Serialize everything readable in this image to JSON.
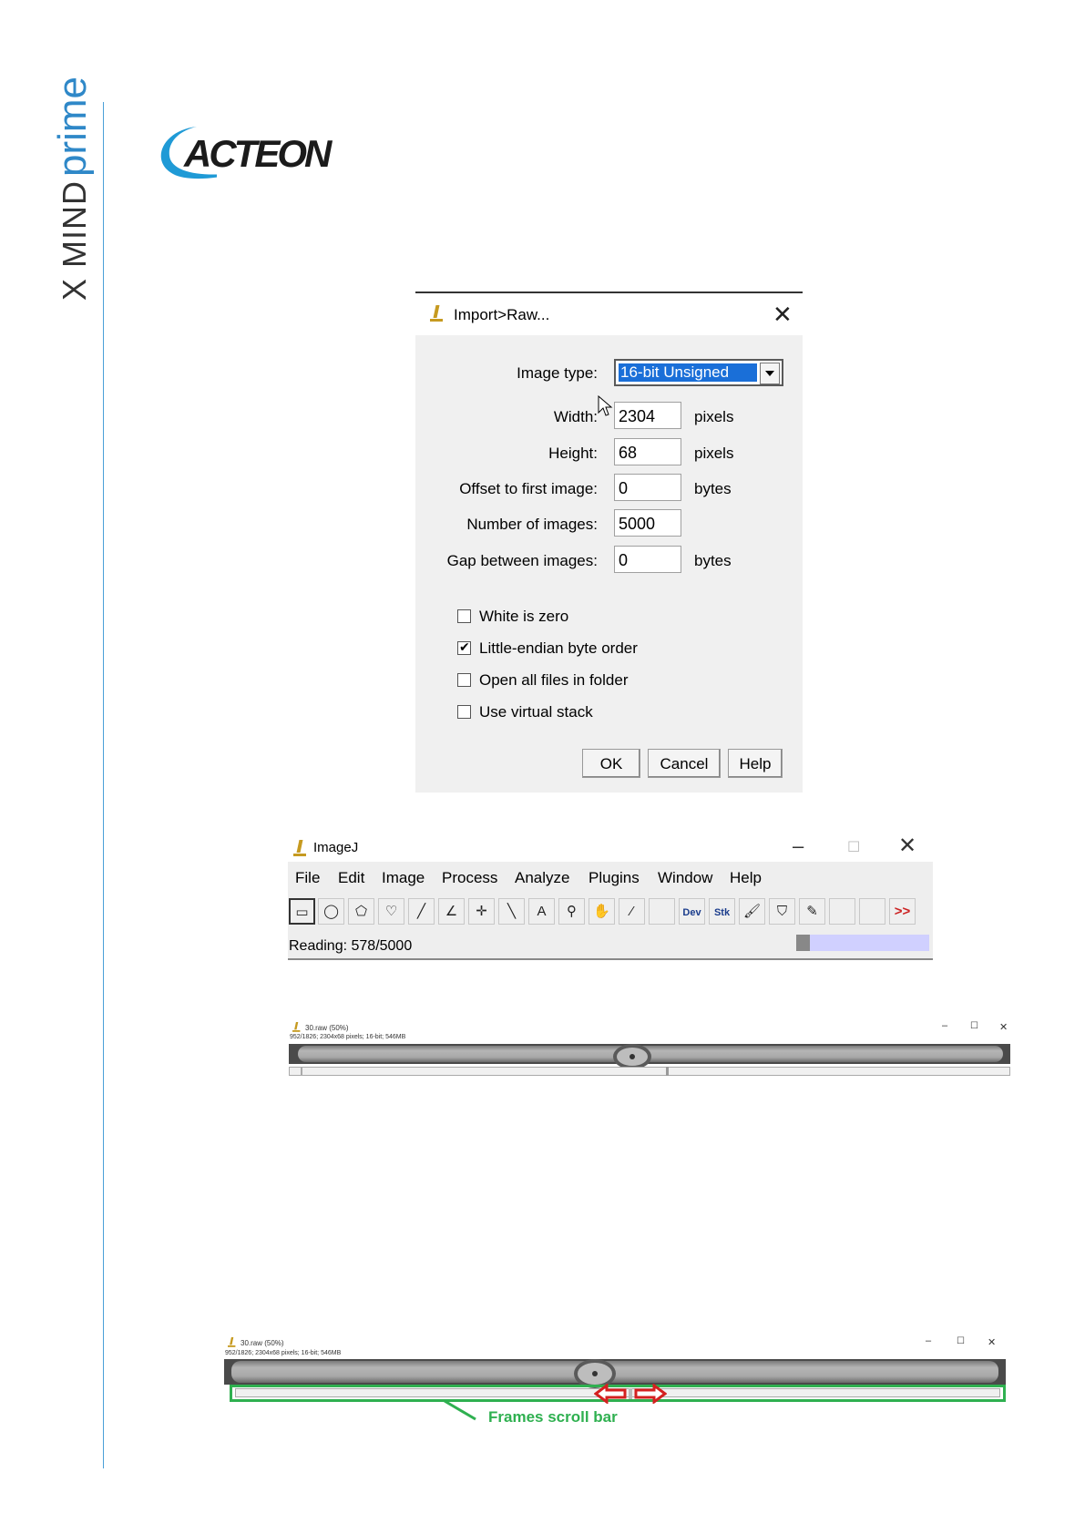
{
  "brand": {
    "vertical_part1": "X MIND",
    "vertical_part2": "prime",
    "logo_text": "ACTEON"
  },
  "dialog": {
    "title": "Import>Raw...",
    "image_type_label": "Image type:",
    "image_type_value": "16-bit Unsigned",
    "fields": [
      {
        "label": "Width:",
        "value": "2304",
        "unit": "pixels"
      },
      {
        "label": "Height:",
        "value": "68",
        "unit": "pixels"
      },
      {
        "label": "Offset to first image:",
        "value": "0",
        "unit": "bytes"
      },
      {
        "label": "Number of images:",
        "value": "5000",
        "unit": ""
      },
      {
        "label": "Gap between images:",
        "value": "0",
        "unit": "bytes"
      }
    ],
    "checkboxes": [
      {
        "label": "White is zero",
        "checked": false
      },
      {
        "label": "Little-endian byte order",
        "checked": true
      },
      {
        "label": "Open all files in folder",
        "checked": false
      },
      {
        "label": "Use virtual stack",
        "checked": false
      }
    ],
    "buttons": {
      "ok": "OK",
      "cancel": "Cancel",
      "help": "Help"
    }
  },
  "imagej": {
    "title": "ImageJ",
    "menus": [
      "File",
      "Edit",
      "Image",
      "Process",
      "Analyze",
      "Plugins",
      "Window",
      "Help"
    ],
    "tools": [
      "rectangle-tool",
      "oval-tool",
      "polygon-tool",
      "freehand-tool",
      "line-tool",
      "angle-tool",
      "point-tool",
      "wand-tool",
      "text-tool",
      "magnifier-tool",
      "hand-tool",
      "color-picker-tool",
      "blank",
      "dev-tool",
      "stk-tool",
      "brush-tool",
      "flood-fill-tool",
      "pencil-tool",
      "blank",
      "blank",
      "more-tools"
    ],
    "dev_label": "Dev",
    "stk_label": "Stk",
    "more_label": ">>",
    "text_glyph": "A",
    "status": "Reading: 578/5000",
    "progress": 0.1
  },
  "image_window_1": {
    "title": "30.raw (50%)",
    "info": "952/1826; 2304x68 pixels; 16-bit; 546MB"
  },
  "image_window_2": {
    "title": "30.raw (50%)",
    "info": "952/1826; 2304x68 pixels; 16-bit; 546MB"
  },
  "annotation": {
    "label": "Frames scroll bar",
    "color": "#2fb050",
    "arrow_color": "#d42020"
  }
}
